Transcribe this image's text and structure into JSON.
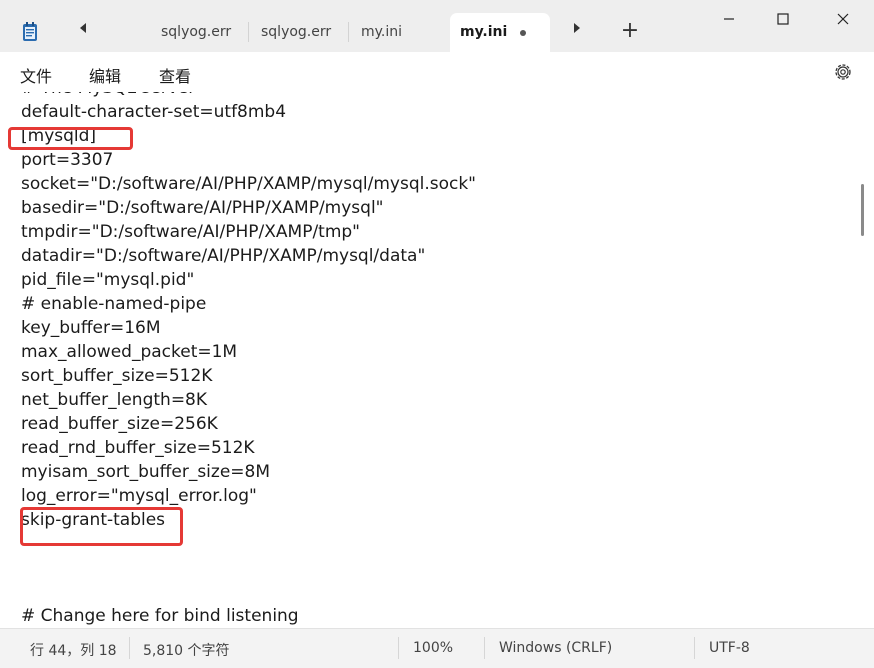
{
  "window": {
    "tabs": [
      {
        "label": "sqlyog.err"
      },
      {
        "label": "sqlyog.err"
      },
      {
        "label": "my.ini"
      },
      {
        "label": "my.ini",
        "active": true,
        "unsaved": true
      }
    ],
    "new_tab_glyph": "+",
    "controls": [
      "minimize-icon",
      "maximize-icon",
      "close-icon"
    ]
  },
  "menu": {
    "file": "文件",
    "edit": "编辑",
    "view": "查看",
    "settings_icon": "gear-icon"
  },
  "editor": {
    "lines": [
      "# The MySQL server",
      "default-character-set=utf8mb4",
      "[mysqld]",
      "port=3307",
      "socket=\"D:/software/AI/PHP/XAMP/mysql/mysql.sock\"",
      "basedir=\"D:/software/AI/PHP/XAMP/mysql\"",
      "tmpdir=\"D:/software/AI/PHP/XAMP/tmp\"",
      "datadir=\"D:/software/AI/PHP/XAMP/mysql/data\"",
      "pid_file=\"mysql.pid\"",
      "# enable-named-pipe",
      "key_buffer=16M",
      "max_allowed_packet=1M",
      "sort_buffer_size=512K",
      "net_buffer_length=8K",
      "read_buffer_size=256K",
      "read_rnd_buffer_size=512K",
      "myisam_sort_buffer_size=8M",
      "log_error=\"mysql_error.log\"",
      "skip-grant-tables",
      "",
      "",
      "",
      "# Change here for bind listening"
    ],
    "highlight_color": "#e53935"
  },
  "status": {
    "position": "行 44，列 18",
    "char_count": "5,810 个字符",
    "zoom": "100%",
    "line_ending": "Windows (CRLF)",
    "encoding": "UTF-8"
  }
}
